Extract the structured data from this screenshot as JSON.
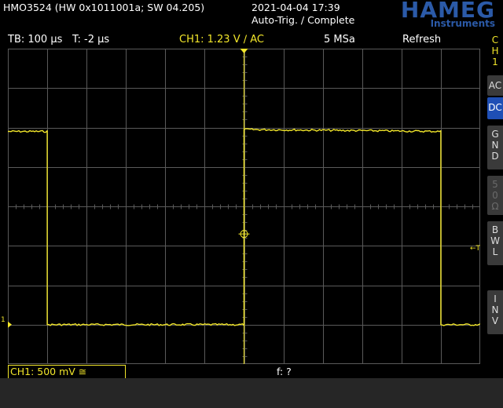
{
  "header": {
    "model": "HMO3524 (HW 0x1011001a; SW 04.205)",
    "datetime": "2021-04-04 17:39",
    "status": "Auto-Trig. / Complete",
    "logo_main": "HAMEG",
    "logo_sub": "Instruments"
  },
  "info_bar": {
    "timebase": "TB: 100 µs",
    "trigger_time": "T: -2 µs",
    "ch1_trigger": "CH1: 1.23 V ∕ AC",
    "sample_rate": "5 MSa",
    "acq_mode": "Refresh"
  },
  "sidebar": {
    "channel_tab": [
      "C",
      "H",
      "1"
    ],
    "buttons": [
      {
        "label": "AC",
        "state": "normal"
      },
      {
        "label": "DC",
        "state": "active"
      },
      {
        "label": "GND",
        "state": "normal"
      },
      {
        "label": "50Ω",
        "state": "disabled"
      },
      {
        "label": "BWL",
        "state": "normal"
      },
      {
        "label": "INV",
        "state": "normal"
      }
    ]
  },
  "bottom": {
    "ch1_scale": "CH1: 500 mV ≅",
    "frequency": "f: ?"
  },
  "markers": {
    "trigger_level": "←T",
    "ground": "1"
  },
  "colors": {
    "trace": "#f2e62a",
    "grid": "#5a5a5a",
    "accent": "#1f4fb5",
    "logo": "#2b5aa8"
  },
  "chart_data": {
    "type": "line",
    "x_divisions": 12,
    "y_divisions": 8,
    "series": [
      {
        "color": "#f2e62a",
        "x": [
          0,
          1.0,
          1.0,
          1.0,
          3.0,
          6.0,
          6.0,
          11.0,
          11.0,
          12.0
        ],
        "y": [
          1.9,
          1.9,
          -3.0,
          -3.0,
          -3.0,
          -3.0,
          1.95,
          1.9,
          -3.0,
          -3.0
        ]
      }
    ],
    "grid": true
  }
}
